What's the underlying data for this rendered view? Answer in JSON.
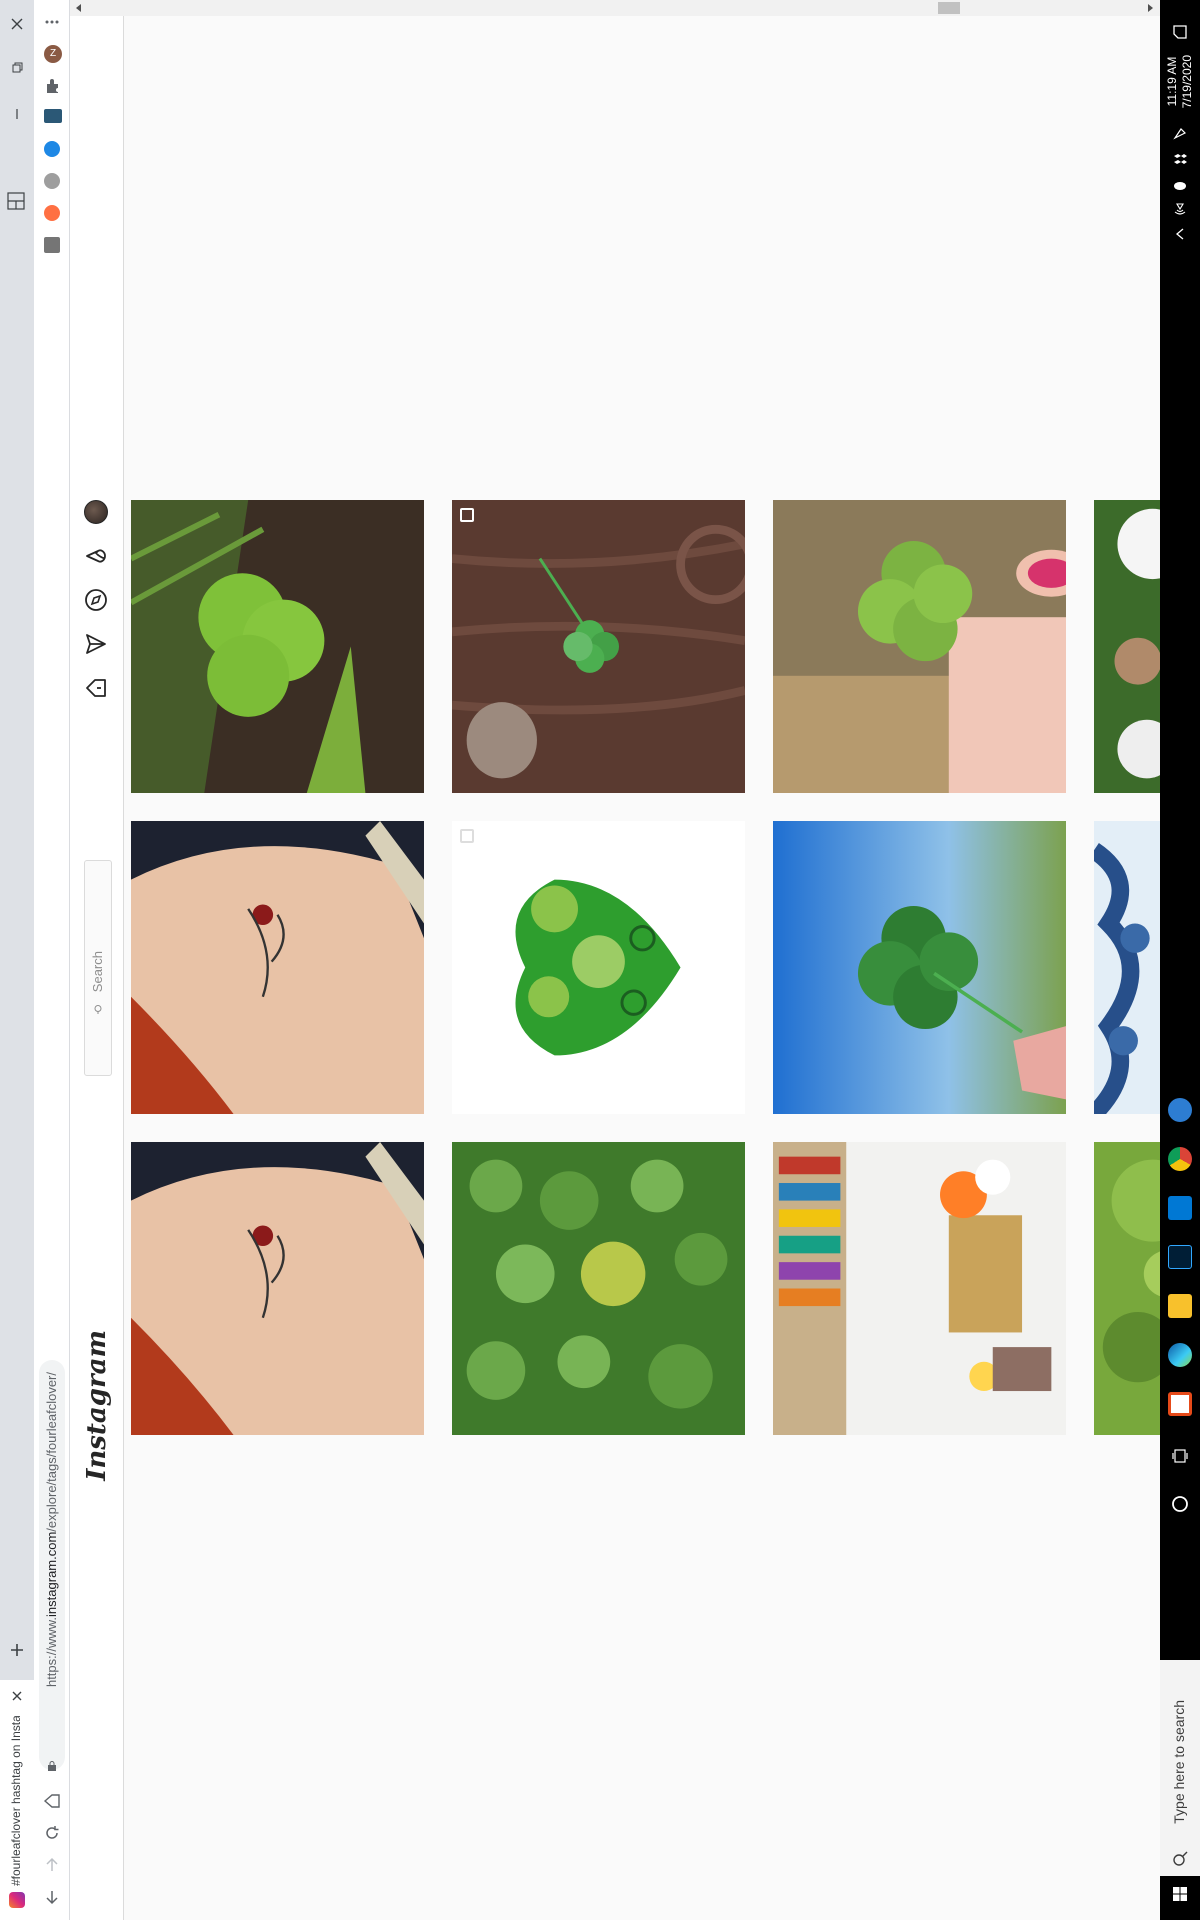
{
  "browser": {
    "tab_title": "#fourleafclover hashtag on Insta...",
    "url_scheme": "https://www.",
    "url_host": "instagram.com",
    "url_path": "/explore/tags/fourleafclover/",
    "profile_initial": "Z"
  },
  "instagram": {
    "logo": "Instagram",
    "search_placeholder": "Search"
  },
  "posts": [
    {
      "description": "oxalis clover in dirt",
      "multi": false
    },
    {
      "description": "four-leaf clover on wood",
      "multi": true
    },
    {
      "description": "hand holding four-leaf clover",
      "multi": false
    },
    {
      "description": "clover flowers (partial)",
      "multi": false
    },
    {
      "description": "clover tattoo on shoulder",
      "multi": false
    },
    {
      "description": "green quilled heart with clovers",
      "multi": true
    },
    {
      "description": "four-leaf clover held against sky",
      "multi": false
    },
    {
      "description": "blue patterned fabric (partial)",
      "multi": false
    },
    {
      "description": "clover tattoo on shoulder",
      "multi": false
    },
    {
      "description": "patch of clovers",
      "multi": false
    },
    {
      "description": "shelf with books and flowers",
      "multi": false
    },
    {
      "description": "green grass (partial)",
      "multi": false
    }
  ],
  "taskbar": {
    "search_placeholder": "Type here to search",
    "time": "11:19 AM",
    "date": "7/19/2020"
  },
  "colors": {
    "ig_text": "#262626",
    "taskbar_bg": "#000000",
    "chrome_tabstrip": "#dee1e6"
  }
}
